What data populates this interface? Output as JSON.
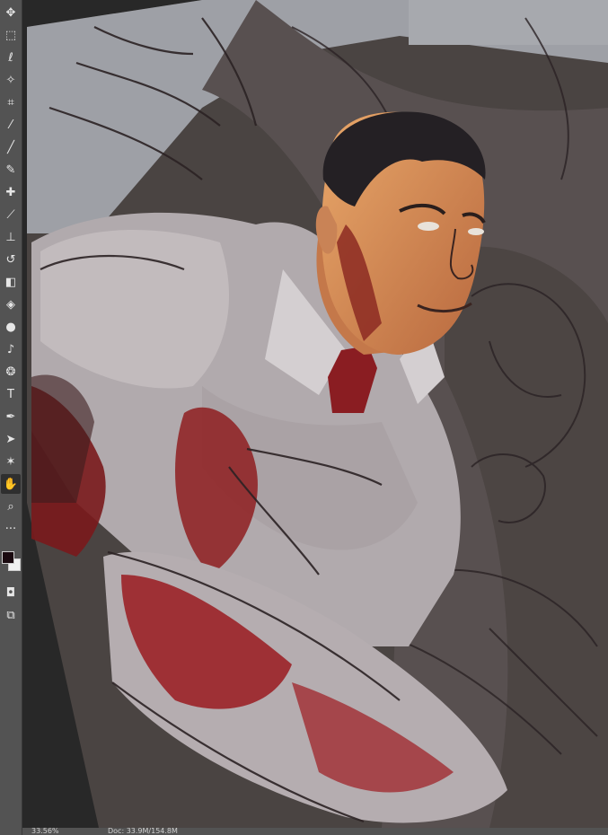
{
  "colors": {
    "toolbar_bg": "#535353",
    "workspace_bg": "#282828",
    "foreground_swatch": "#1a0a10",
    "background_swatch": "#f0f0f0"
  },
  "toolbar": {
    "tools": [
      {
        "name": "move-tool",
        "icon": "move-icon",
        "glyph": "✥"
      },
      {
        "name": "marquee-tool",
        "icon": "marquee-icon",
        "glyph": "⬚"
      },
      {
        "name": "lasso-tool",
        "icon": "lasso-icon",
        "glyph": "ℓ"
      },
      {
        "name": "magic-wand-tool",
        "icon": "magic-wand-icon",
        "glyph": "✧"
      },
      {
        "name": "crop-tool",
        "icon": "crop-icon",
        "glyph": "⌗"
      },
      {
        "name": "eyedropper-tool",
        "icon": "eyedropper-icon",
        "glyph": "⁄"
      },
      {
        "name": "brush-tool",
        "icon": "brush-icon",
        "glyph": "╱"
      },
      {
        "name": "pencil-tool",
        "icon": "pencil-icon",
        "glyph": "✎"
      },
      {
        "name": "healing-tool",
        "icon": "healing-icon",
        "glyph": "✚"
      },
      {
        "name": "mixer-brush-tool",
        "icon": "mixer-brush-icon",
        "glyph": "⟋"
      },
      {
        "name": "stamp-tool",
        "icon": "stamp-icon",
        "glyph": "⊥"
      },
      {
        "name": "history-brush-tool",
        "icon": "history-brush-icon",
        "glyph": "↺"
      },
      {
        "name": "eraser-tool",
        "icon": "eraser-icon",
        "glyph": "◧"
      },
      {
        "name": "paint-bucket-tool",
        "icon": "paint-bucket-icon",
        "glyph": "◈"
      },
      {
        "name": "blur-tool",
        "icon": "blur-icon",
        "glyph": "●"
      },
      {
        "name": "dodge-tool",
        "icon": "dodge-icon",
        "glyph": "♪"
      },
      {
        "name": "sponge-tool",
        "icon": "sponge-icon",
        "glyph": "❂"
      },
      {
        "name": "type-tool",
        "icon": "type-icon",
        "glyph": "T"
      },
      {
        "name": "pen-tool",
        "icon": "pen-icon",
        "glyph": "✒"
      },
      {
        "name": "path-selection-tool",
        "icon": "path-selection-icon",
        "glyph": "➤"
      },
      {
        "name": "custom-shape-tool",
        "icon": "custom-shape-icon",
        "glyph": "✶"
      },
      {
        "name": "hand-tool",
        "icon": "hand-icon",
        "glyph": "✋",
        "active": true
      },
      {
        "name": "zoom-tool",
        "icon": "zoom-icon",
        "glyph": "⌕"
      },
      {
        "name": "more-tools",
        "icon": "more-icon",
        "glyph": "···"
      }
    ],
    "bottom_tools": [
      {
        "name": "quick-mask-button",
        "icon": "quick-mask-icon",
        "glyph": "◘"
      },
      {
        "name": "screen-mode-button",
        "icon": "screen-mode-icon",
        "glyph": "⧉"
      }
    ]
  },
  "status": {
    "zoom": "33.56%",
    "doc_info": "Doc: 33.9M/154.8M"
  }
}
